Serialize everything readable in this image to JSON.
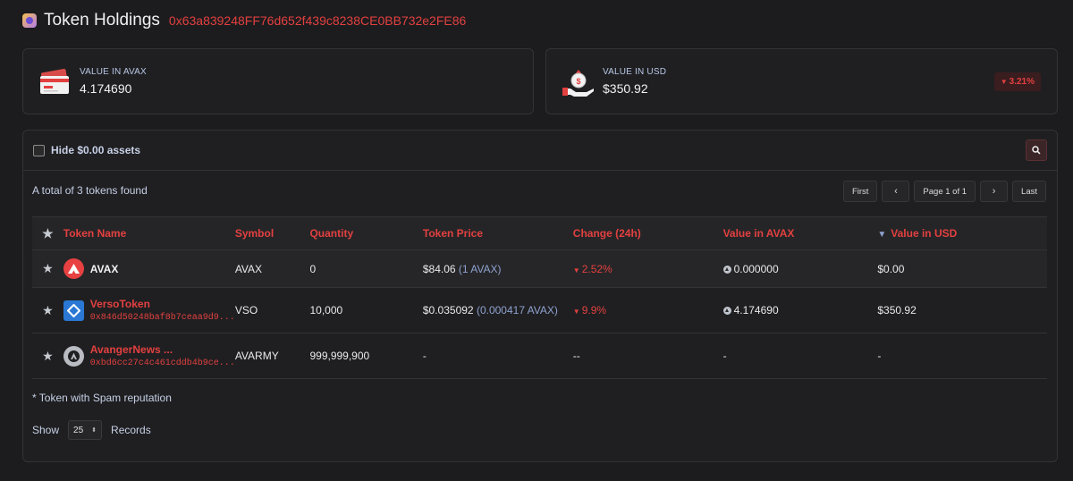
{
  "header": {
    "title": "Token Holdings",
    "address": "0x63a839248FF76d652f439c8238CE0BB732e2FE86"
  },
  "summary": {
    "avax": {
      "label": "VALUE IN AVAX",
      "value": "4.174690"
    },
    "usd": {
      "label": "VALUE IN USD",
      "value": "$350.92",
      "change": "3.21%"
    }
  },
  "filter": {
    "hide_label": "Hide $0.00 assets"
  },
  "list": {
    "total_text": "A total of 3 tokens found"
  },
  "pager": {
    "first": "First",
    "prev": "‹",
    "page": "Page 1 of 1",
    "next": "›",
    "last": "Last"
  },
  "table": {
    "headers": [
      "Token Name",
      "Symbol",
      "Quantity",
      "Token Price",
      "Change (24h)",
      "Value in AVAX",
      "Value in USD"
    ],
    "rows": [
      {
        "name": "AVAX",
        "address": "",
        "symbol": "AVAX",
        "quantity": "0",
        "price": "$84.06",
        "price_avax": "(1 AVAX)",
        "change": "2.52%",
        "value_avax": "0.000000",
        "value_usd": "$0.00"
      },
      {
        "name": "VersoToken",
        "address": "0x846d50248baf8b7ceaa9d9...",
        "symbol": "VSO",
        "quantity": "10,000",
        "price": "$0.035092",
        "price_avax": "(0.000417 AVAX)",
        "change": "9.9%",
        "value_avax": "4.174690",
        "value_usd": "$350.92"
      },
      {
        "name": "AvangerNews ...",
        "address": "0xbd6cc27c4c461cddb4b9ce...",
        "symbol": "AVARMY",
        "quantity": "999,999,900",
        "price": "-",
        "price_avax": "",
        "change": "--",
        "value_avax": "-",
        "value_usd": "-"
      }
    ]
  },
  "footer": {
    "spam_note": "* Token with Spam reputation",
    "show_label": "Show",
    "records_value": "25",
    "records_label": "Records"
  },
  "colors": {
    "accent_red": "#e34040",
    "background": "#1c1c1e"
  }
}
